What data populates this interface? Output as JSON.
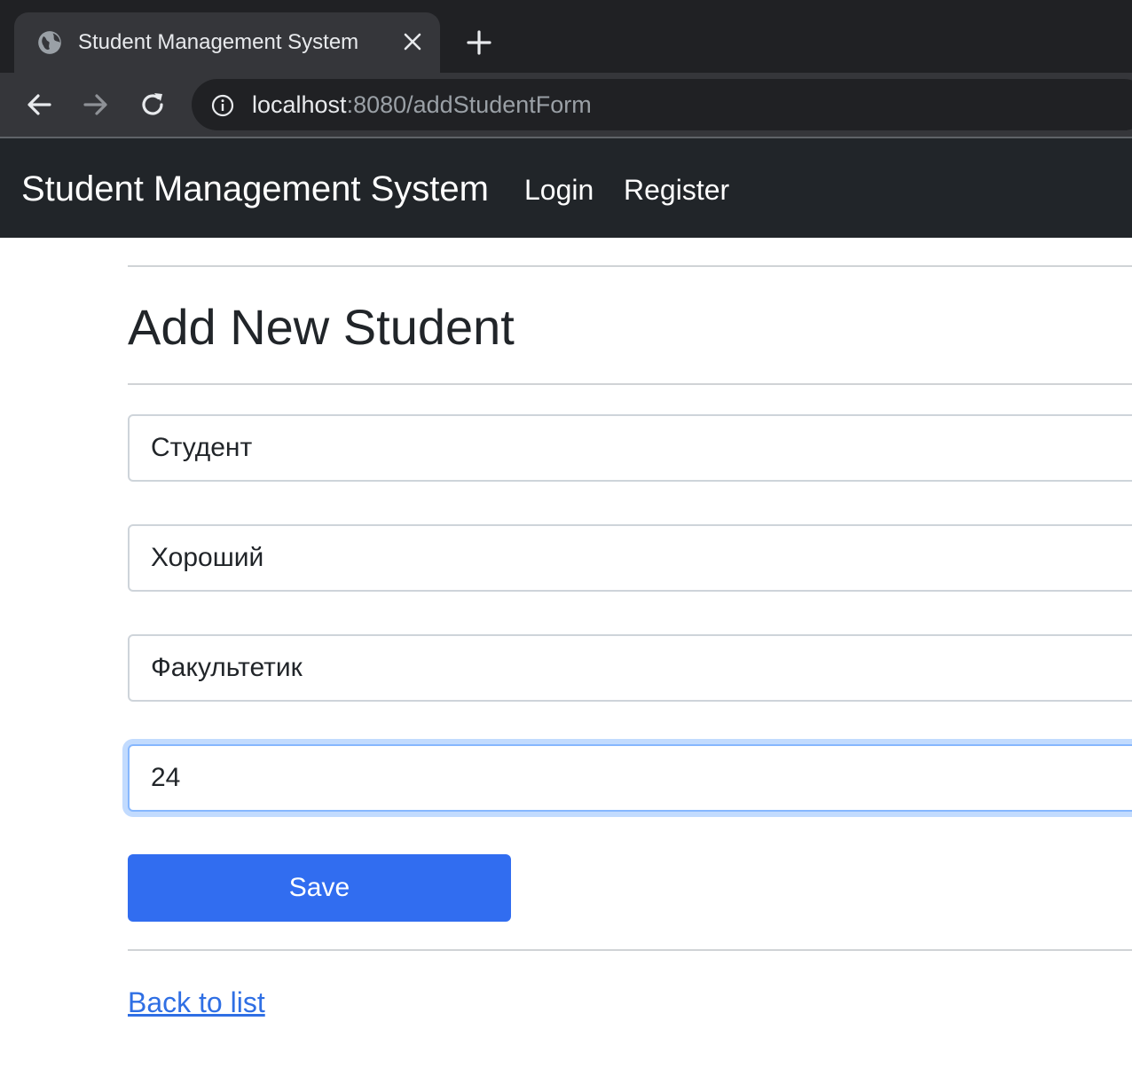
{
  "browser": {
    "tab_title": "Student Management System",
    "url_host": "localhost",
    "url_rest": ":8080/addStudentForm"
  },
  "navbar": {
    "brand": "Student Management System",
    "links": [
      "Login",
      "Register"
    ]
  },
  "page": {
    "title": "Add New Student"
  },
  "form": {
    "first_name": "Студент",
    "last_name": "Хороший",
    "faculty": "Факультетик",
    "age": "24",
    "save_label": "Save"
  },
  "back_link": "Back to list",
  "colors": {
    "chrome_dark": "#202124",
    "chrome_toolbar": "#35363a",
    "navbar": "#212529",
    "primary": "#316df0",
    "link": "#2f6fe4"
  },
  "icons": {
    "tab": "globe-icon",
    "close": "close-icon",
    "new_tab": "plus-icon",
    "back": "arrow-left-icon",
    "forward": "arrow-right-icon",
    "reload": "reload-icon",
    "site_info": "info-icon"
  }
}
